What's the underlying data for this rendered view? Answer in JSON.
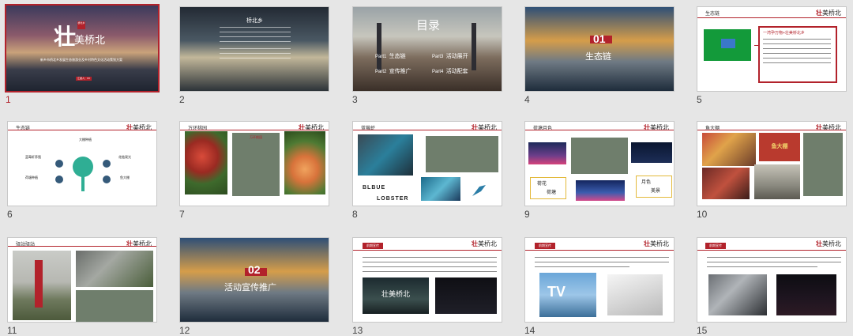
{
  "slides": [
    {
      "number": "1",
      "selected": true,
      "title_big": "壮",
      "title_rest": "美桥北",
      "seal": "桥北乡",
      "subtitle": "新乡市桥北乡发展生态旅游业及乡村特色文化活动策划方案",
      "red_button": "汇报人：XX"
    },
    {
      "number": "2",
      "title": "桥北乡"
    },
    {
      "number": "3",
      "title": "目录",
      "items": [
        {
          "part": "Part1",
          "label": "生态链"
        },
        {
          "part": "Part3",
          "label": "活动展开"
        },
        {
          "part": "Part2",
          "label": "宣传推广"
        },
        {
          "part": "Part4",
          "label": "活动配套"
        }
      ]
    },
    {
      "number": "4",
      "section_number": "01",
      "section_title": "生态链"
    },
    {
      "number": "5",
      "header": "生态链",
      "callout_title": "一湾孕万物+壮美桥北乡"
    },
    {
      "number": "6",
      "header": "生态链",
      "labels": [
        "大棚种植",
        "蓝莓虾养殖",
        "花链观光",
        "荷塘种植",
        "鱼大棚"
      ]
    },
    {
      "number": "7",
      "header": "万环桃园",
      "box_title": "万环桃园"
    },
    {
      "number": "8",
      "header": "蓝莓虾",
      "logo_line1": "BLBUE",
      "logo_line2": "LOBSTER"
    },
    {
      "number": "9",
      "header": "荷塘月色",
      "label_left_1": "荷花",
      "label_left_2": "荷塘",
      "label_right_1": "月色",
      "label_right_2": "美景"
    },
    {
      "number": "10",
      "header": "鱼大棚",
      "gate_text": "鱼大棚"
    },
    {
      "number": "11",
      "header": "驿站驿站"
    },
    {
      "number": "12",
      "section_number": "02",
      "section_title": "活动宣传推广"
    },
    {
      "number": "13",
      "tag": "前期宣传",
      "logo_overlay": "壮美桥北"
    },
    {
      "number": "14",
      "tag": "前期宣传",
      "tv_text": "TV"
    },
    {
      "number": "15",
      "tag": "前期宣传"
    }
  ],
  "colors": {
    "accent": "#b2222b",
    "panel_bg": "#e6e6e6",
    "grey_box": "#6f7e6c"
  },
  "logo_small": {
    "bold": "壮",
    "rest": "美桥北"
  }
}
